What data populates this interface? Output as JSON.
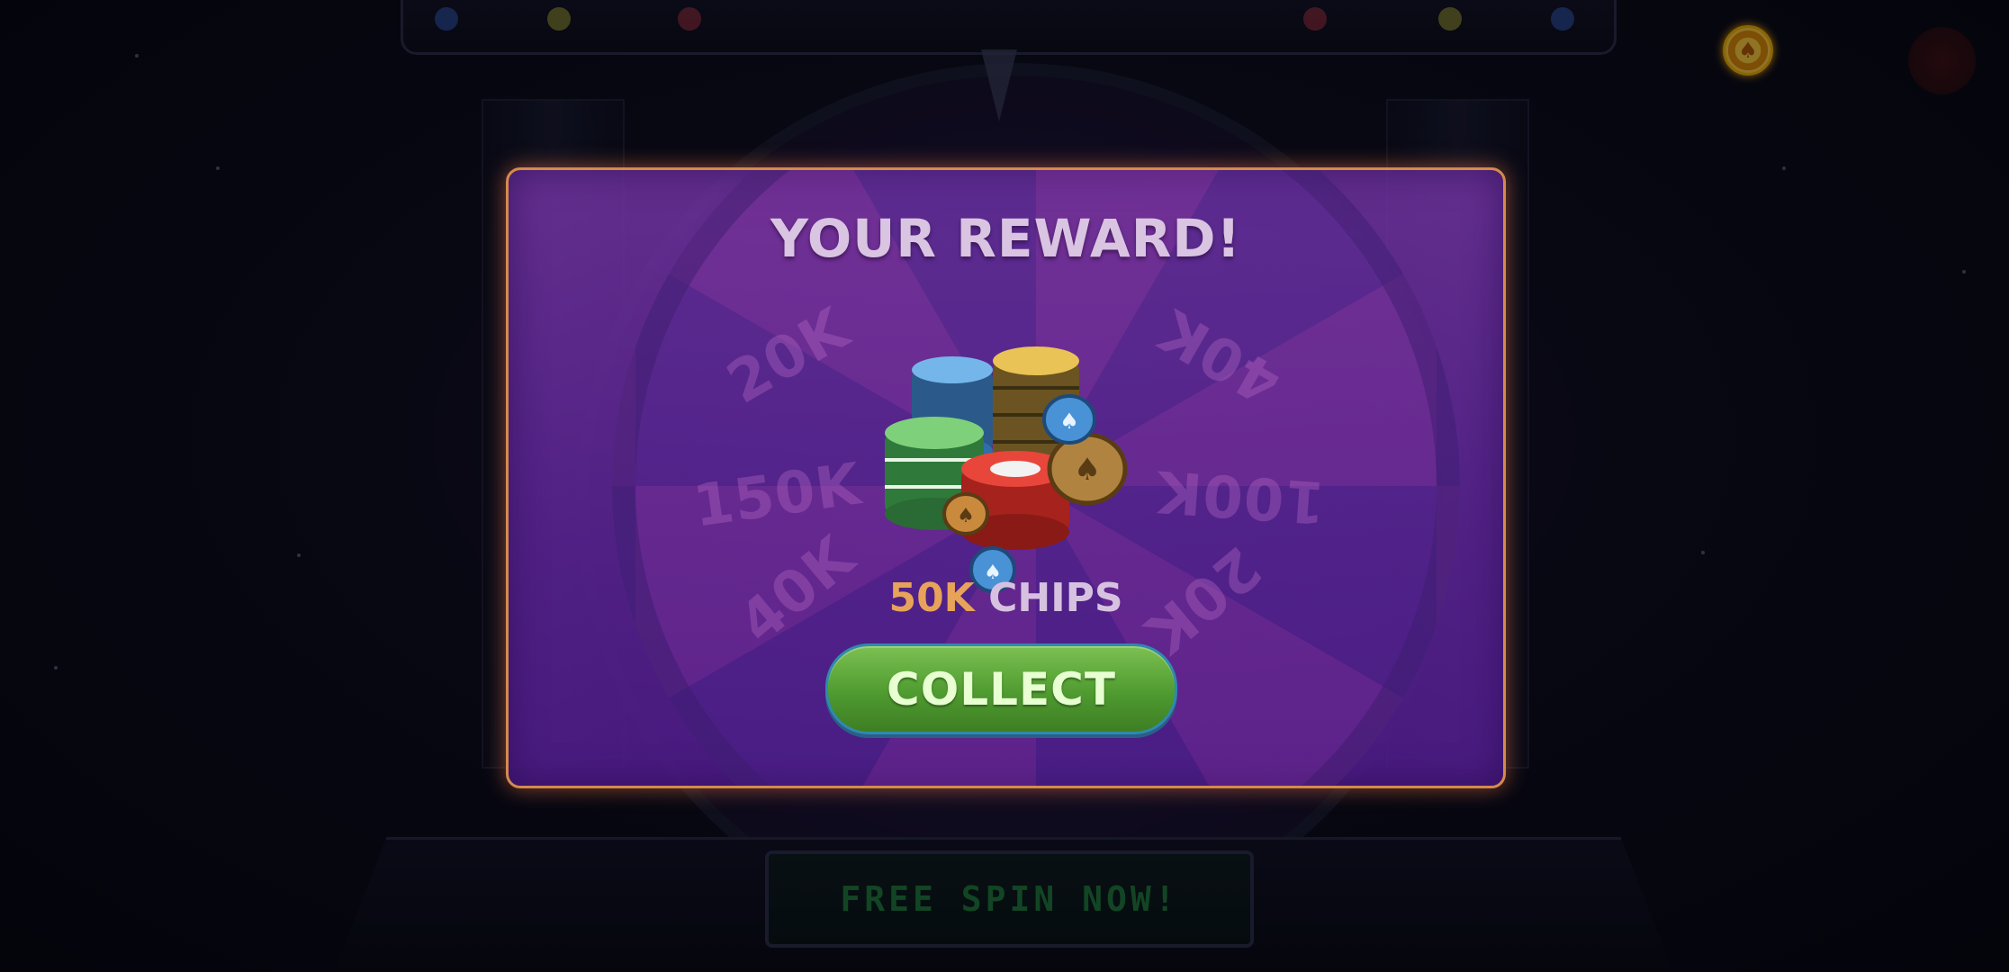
{
  "background": {
    "free_spin_label": "FREE SPIN NOW!"
  },
  "popup": {
    "title": "YOUR REWARD!",
    "wheel_labels": [
      "150K",
      "100K",
      "40K",
      "20K",
      "20K",
      "40K"
    ],
    "reward_amount": "50K",
    "reward_unit": "CHIPS",
    "collect_label": "COLLECT"
  },
  "hud": {
    "chip_icon": "chip-icon",
    "avatar_icon": "avatar-icon"
  },
  "colors": {
    "popup_border": "#d58a4b",
    "reward_amount": "#e8a35a",
    "collect_button": "#5aa638"
  }
}
